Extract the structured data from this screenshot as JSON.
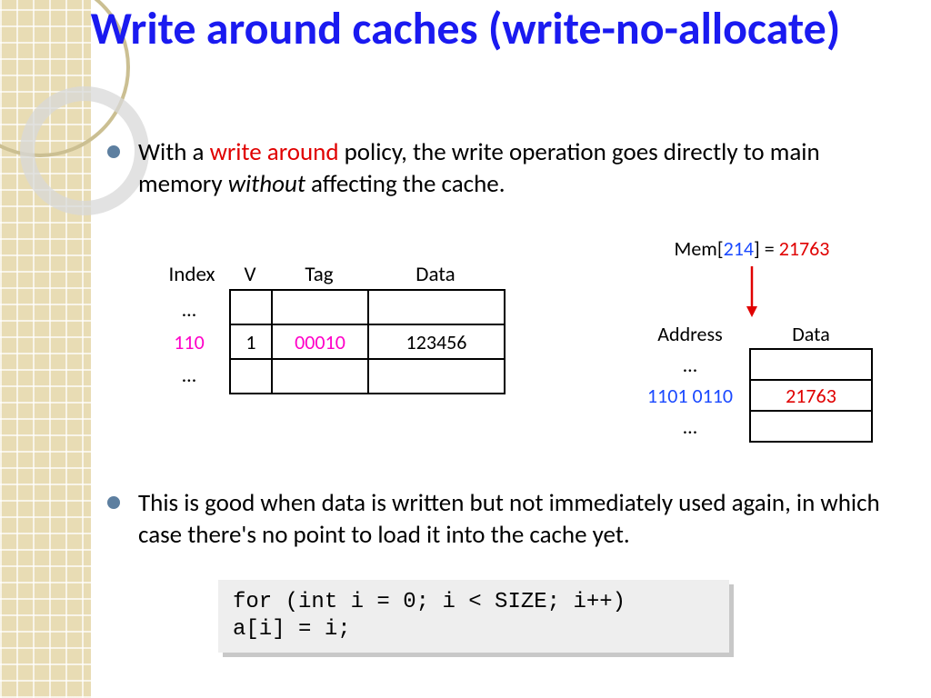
{
  "title": "Write around caches (write-no-allocate)",
  "bullet1": {
    "pre": "With a ",
    "highlight": "write around",
    "mid": " policy, the write operation goes directly to main memory ",
    "ital": "without",
    "post": " affecting the cache."
  },
  "cache": {
    "headers": {
      "index": "Index",
      "v": "V",
      "tag": "Tag",
      "data": "Data"
    },
    "index_labels": [
      "…",
      "110",
      "…"
    ],
    "row": {
      "v": "1",
      "tag": "00010",
      "data": "123456"
    }
  },
  "mem_write": {
    "pre": "Mem[",
    "addr": "214",
    "mid": "] = ",
    "val": "21763"
  },
  "memory": {
    "addr_header": "Address",
    "data_header": "Data",
    "addr_labels": [
      "…",
      "1101 0110",
      "…"
    ],
    "hit_value": "21763"
  },
  "bullet2": "This is good when data is written but not immediately used again, in which case there's no point to load it into the cache yet.",
  "code": "for (int i = 0; i < SIZE; i++)\na[i] = i;"
}
